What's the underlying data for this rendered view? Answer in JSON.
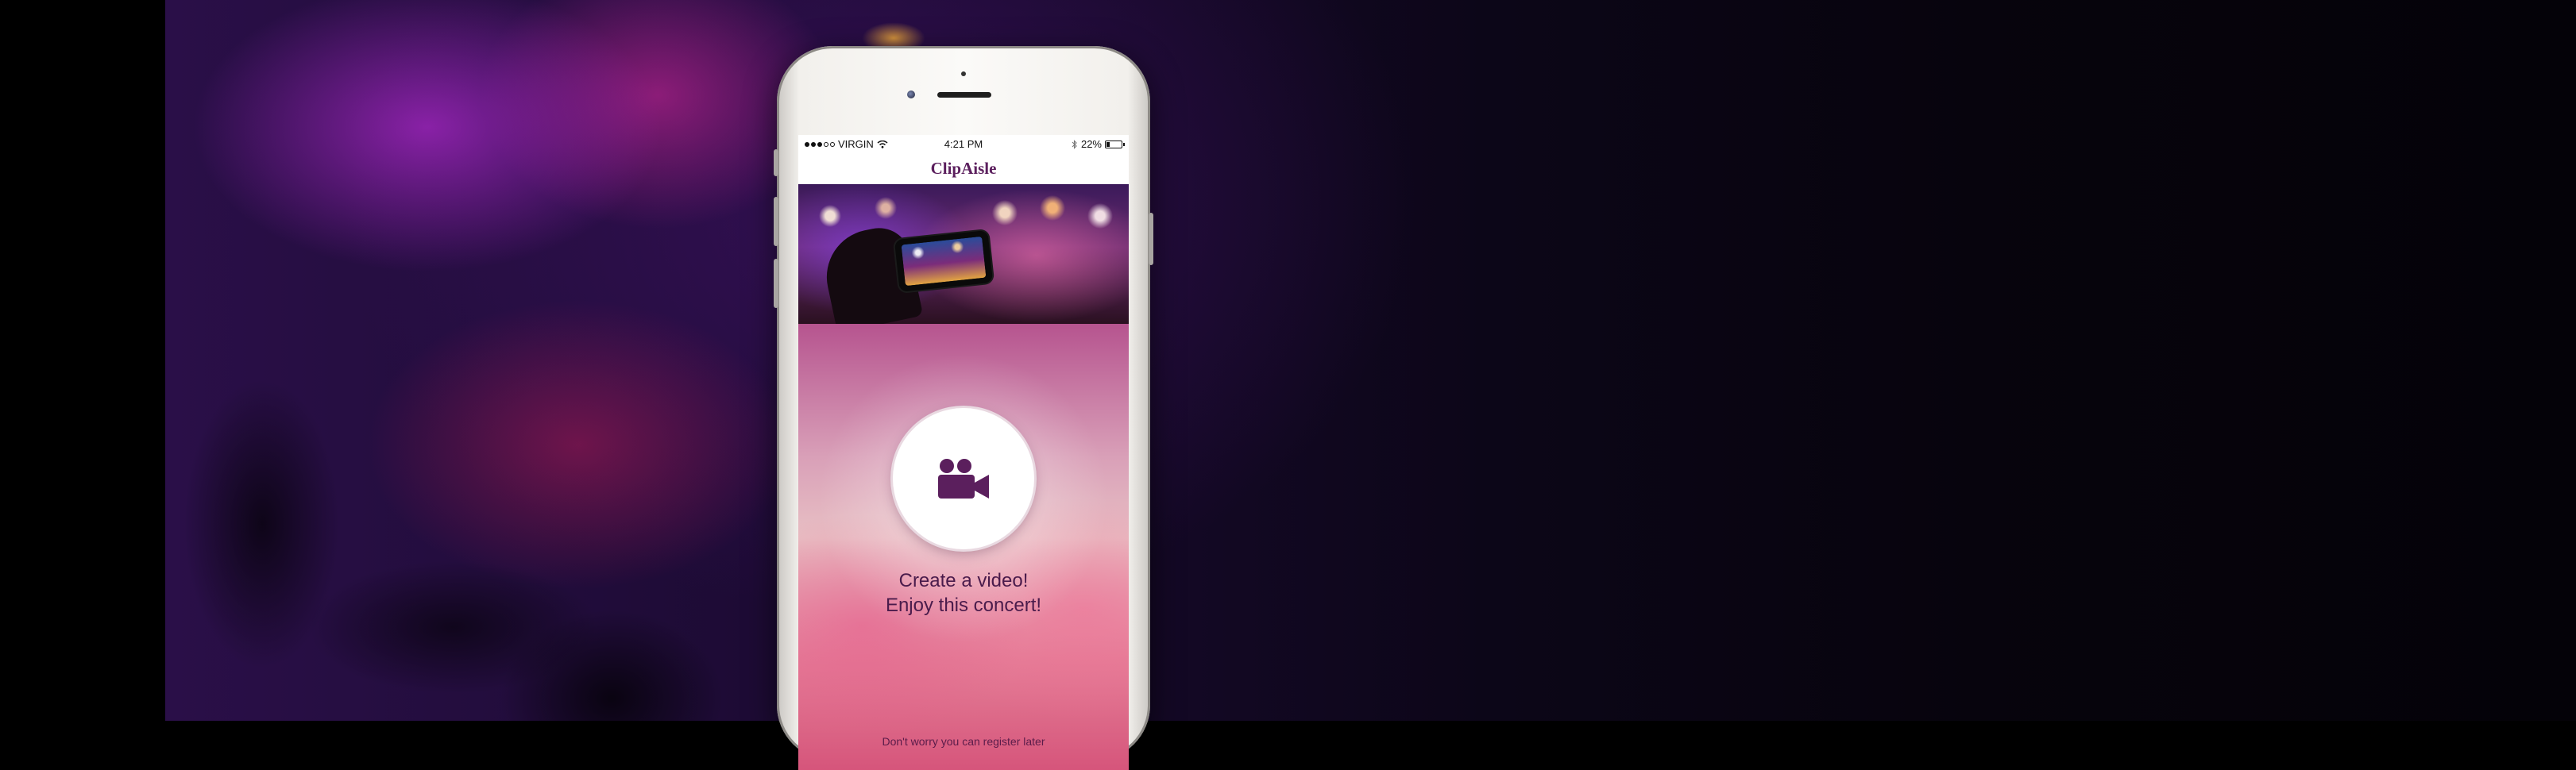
{
  "status_bar": {
    "carrier": "VIRGIN",
    "time": "4:21 PM",
    "battery_percent": "22%",
    "battery_level": 0.22,
    "signal_bars": 3
  },
  "app": {
    "logo": "ClipAisle"
  },
  "main": {
    "record_icon": "video-camera-icon",
    "headline_line1": "Create a video!",
    "headline_line2": "Enjoy this concert!",
    "register_later": "Don't worry you can register later"
  },
  "colors": {
    "brand": "#5b1f5d",
    "text_dark": "#4a1b4b"
  }
}
